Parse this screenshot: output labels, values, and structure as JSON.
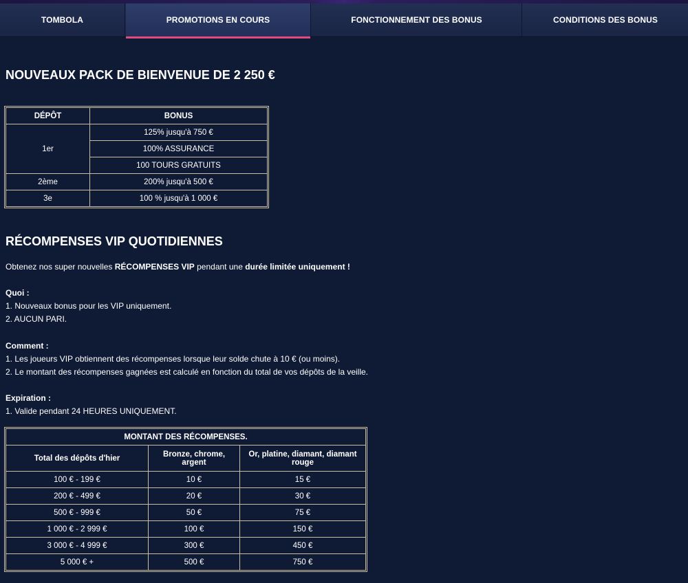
{
  "tabs": [
    {
      "label": "TOMBOLA"
    },
    {
      "label": "PROMOTIONS EN COURS"
    },
    {
      "label": "FONCTIONNEMENT DES BONUS"
    },
    {
      "label": "CONDITIONS DES BONUS"
    }
  ],
  "active_tab_color": "#e2497c",
  "welcome": {
    "title": "NOUVEAUX PACK DE BIENVENUE DE 2 250 €",
    "headers": {
      "deposit": "DÉPÔT",
      "bonus": "BONUS"
    },
    "rows": [
      {
        "deposit": "1er",
        "bonuses": [
          "125% jusqu'à 750 €",
          "100% ASSURANCE",
          "100 TOURS GRATUITS"
        ]
      },
      {
        "deposit": "2ème",
        "bonuses": [
          "200% jusqu'à 500 €"
        ]
      },
      {
        "deposit": "3e",
        "bonuses": [
          "100 % jusqu'à 1 000 €"
        ]
      }
    ]
  },
  "vip": {
    "title": "RÉCOMPENSES VIP QUOTIDIENNES",
    "intro": {
      "pre": "Obtenez nos super nouvelles ",
      "bold1": "RÉCOMPENSES VIP",
      "mid": " pendant une ",
      "bold2": "durée limitée uniquement !"
    },
    "what": {
      "heading": "Quoi :",
      "items": [
        "1. Nouveaux bonus pour les VIP uniquement.",
        "2. AUCUN PARI."
      ]
    },
    "how": {
      "heading": "Comment :",
      "items": [
        "1. Les joueurs VIP obtiennent des récompenses lorsque leur solde chute à 10 € (ou moins).",
        "2. Le montant des récompenses gagnées est calculé en fonction du total de vos dépôts de la veille."
      ]
    },
    "expiry": {
      "heading": "Expiration :",
      "items": [
        "1. Valide pendant 24 HEURES UNIQUEMENT."
      ]
    },
    "rewards_table": {
      "caption": "MONTANT DES RÉCOMPENSES.",
      "headers": [
        "Total des dépôts d'hier",
        "Bronze, chrome, argent",
        "Or, platine, diamant, diamant rouge"
      ],
      "rows": [
        [
          "100 € - 199 €",
          "10 €",
          "15 €"
        ],
        [
          "200 € - 499 €",
          "20 €",
          "30 €"
        ],
        [
          "500 € - 999 €",
          "50 €",
          "75 €"
        ],
        [
          "1 000 € - 2 999 €",
          "100 €",
          "150 €"
        ],
        [
          "3 000 € - 4 999 €",
          "300 €",
          "450 €"
        ],
        [
          "5 000 € +",
          "500 €",
          "750 €"
        ]
      ]
    }
  }
}
